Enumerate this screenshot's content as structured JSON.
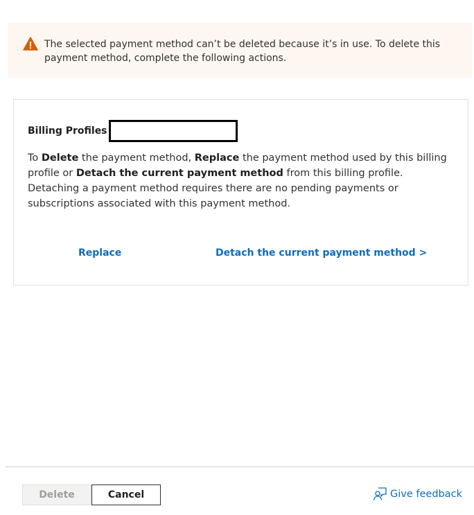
{
  "banner": {
    "icon": "warning-icon",
    "icon_color": "#d65f09",
    "message": "The selected payment method can’t be deleted because it’s in use. To delete this payment method, complete the following actions."
  },
  "card": {
    "profile_label": "Billing Profiles",
    "body": {
      "p1": "To ",
      "b1": "Delete",
      "p2": " the payment method, ",
      "b2": "Replace",
      "p3": " the payment method used by this billing profile or ",
      "b3": "Detach the current payment method",
      "p4": " from this billing profile. Detaching a payment method requires there are no pending payments or subscriptions associated with this payment method."
    },
    "replace_link": "Replace",
    "detach_link": "Detach the current payment method >"
  },
  "footer": {
    "delete_label": "Delete",
    "cancel_label": "Cancel",
    "feedback_label": "Give feedback",
    "feedback_icon": "feedback-person-icon"
  },
  "colors": {
    "accent": "#0f6cbd",
    "banner_background": "#fdf6f1",
    "warning": "#d65f09"
  }
}
